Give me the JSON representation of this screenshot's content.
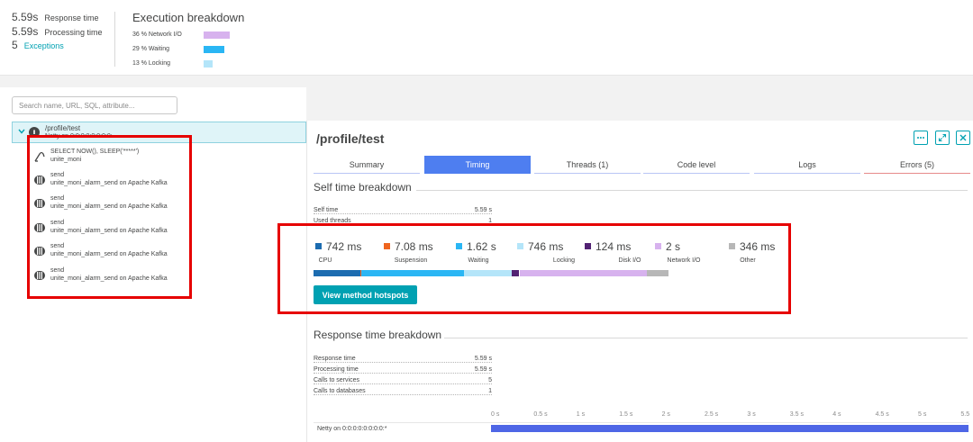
{
  "summary": {
    "response_time": {
      "value": "5.59s",
      "label": "Response time"
    },
    "processing_time": {
      "value": "5.59s",
      "label": "Processing time"
    },
    "exceptions": {
      "value": "5",
      "label": "Exceptions"
    }
  },
  "execution": {
    "title": "Execution breakdown",
    "rows": [
      {
        "label": "36 % Network I/O",
        "percent": 36,
        "color": "#d7b2ee"
      },
      {
        "label": "29 % Waiting",
        "percent": 29,
        "color": "#2ab6f4"
      },
      {
        "label": "13 % Locking",
        "percent": 13,
        "color": "#b4e5f9"
      }
    ]
  },
  "search": {
    "placeholder": "Search name, URL, SQL, attribute..."
  },
  "tree": {
    "root": {
      "title": "/profile/test",
      "subtitle": "Netty on 0:0:0:0:0:0:0:0:",
      "icon": "error-exclamation-icon"
    },
    "items": [
      {
        "title": "SELECT NOW(), SLEEP('*****')",
        "subtitle": "unite_moni",
        "icon": "database-query-icon"
      },
      {
        "title": "send",
        "subtitle": "unite_moni_alarm_send on Apache Kafka",
        "icon": "messaging-queue-icon"
      },
      {
        "title": "send",
        "subtitle": "unite_moni_alarm_send on Apache Kafka",
        "icon": "messaging-queue-icon"
      },
      {
        "title": "send",
        "subtitle": "unite_moni_alarm_send on Apache Kafka",
        "icon": "messaging-queue-icon"
      },
      {
        "title": "send",
        "subtitle": "unite_moni_alarm_send on Apache Kafka",
        "icon": "messaging-queue-icon"
      },
      {
        "title": "send",
        "subtitle": "unite_moni_alarm_send on Apache Kafka",
        "icon": "messaging-queue-icon"
      }
    ]
  },
  "detail": {
    "title": "/profile/test",
    "actions": [
      {
        "icon": "more-icon"
      },
      {
        "icon": "expand-icon"
      },
      {
        "icon": "close-icon"
      }
    ],
    "tabs": [
      {
        "label": "Summary",
        "active": false
      },
      {
        "label": "Timing",
        "active": true
      },
      {
        "label": "Threads (1)",
        "active": false
      },
      {
        "label": "Code level",
        "active": false
      },
      {
        "label": "Logs",
        "active": false
      },
      {
        "label": "Errors (5)",
        "active": false
      }
    ]
  },
  "self_time": {
    "title": "Self time breakdown",
    "rows": [
      {
        "key": "Self time",
        "value": "5.59 s"
      },
      {
        "key": "Used threads",
        "value": "1"
      }
    ],
    "categories": [
      {
        "value": "742 ms",
        "label": "CPU",
        "seconds": 0.742,
        "color": "#1c6cb0"
      },
      {
        "value": "7.08 ms",
        "label": "Suspension",
        "seconds": 0.00708,
        "color": "#ef651f"
      },
      {
        "value": "1.62 s",
        "label": "Waiting",
        "seconds": 1.62,
        "color": "#2ab6f4"
      },
      {
        "value": "746 ms",
        "label": "Locking",
        "seconds": 0.746,
        "color": "#b4e5f9"
      },
      {
        "value": "124 ms",
        "label": "Disk I/O",
        "seconds": 0.124,
        "color": "#522273"
      },
      {
        "value": "2 s",
        "label": "Network I/O",
        "seconds": 2.0,
        "color": "#d7b2ee"
      },
      {
        "value": "346 ms",
        "label": "Other",
        "seconds": 0.346,
        "color": "#b7b7b7"
      }
    ],
    "button_label": "View method hotspots"
  },
  "response_time": {
    "title": "Response time breakdown",
    "rows": [
      {
        "key": "Response time",
        "value": "5.59 s"
      },
      {
        "key": "Processing time",
        "value": "5.59 s"
      },
      {
        "key": "Calls to services",
        "value": "5"
      },
      {
        "key": "Calls to databases",
        "value": "1"
      }
    ]
  },
  "timeline": {
    "ticks": [
      "0 s",
      "0.5 s",
      "1 s",
      "1.5 s",
      "2 s",
      "2.5 s",
      "3 s",
      "3.5 s",
      "4 s",
      "4.5 s",
      "5 s",
      "5.5"
    ],
    "row_label": "Netty on 0:0:0:0:0:0:0:0:*",
    "duration_s": 5.59
  }
}
